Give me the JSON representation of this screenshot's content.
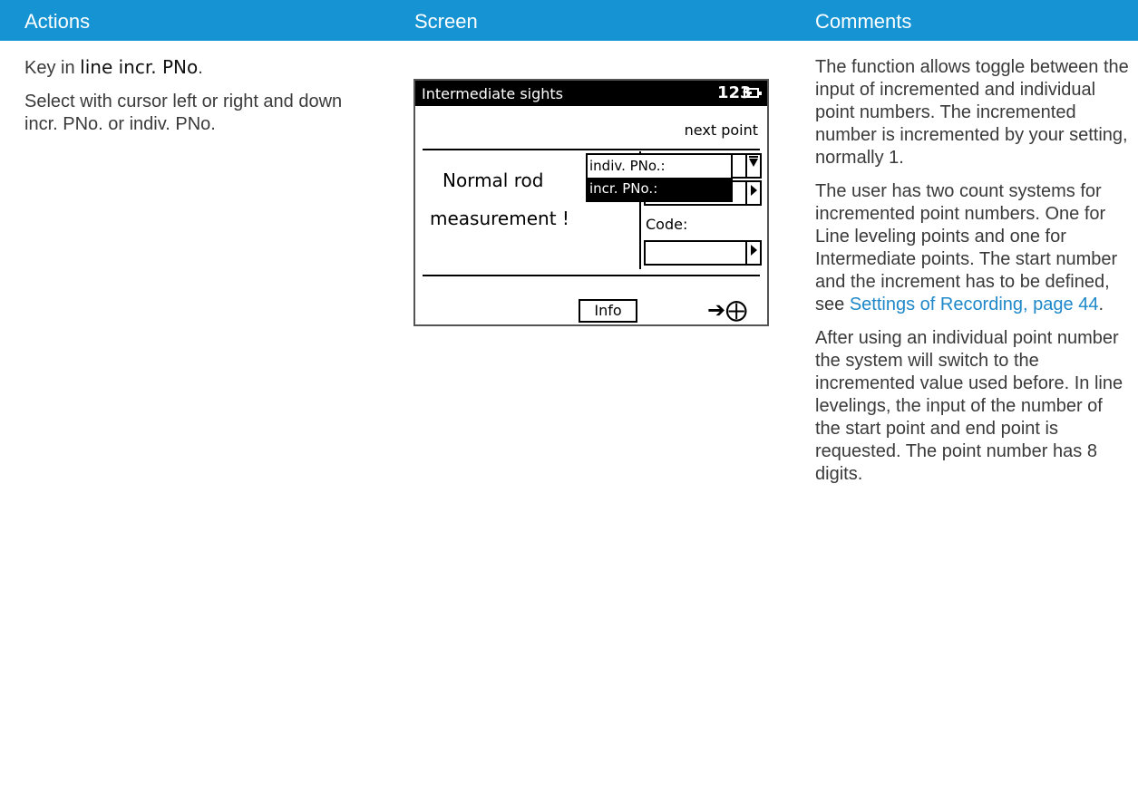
{
  "header": {
    "actions": "Actions",
    "screen": "Screen",
    "comments": "Comments"
  },
  "actions": {
    "p1_prefix": "Key in ",
    "p1_keyword": "line incr. PNo",
    "p1_suffix": ".",
    "p2": "Select with cursor left or right and down incr. PNo. or indiv. PNo."
  },
  "device": {
    "title": "Intermediate sights",
    "mode": "123",
    "next_point": "next point",
    "message_line1": "Normal rod",
    "message_line2": "measurement !",
    "dropdown_option_1": "indiv. PNo.:",
    "dropdown_option_2": "incr. PNo.:",
    "code_label": "Code:",
    "info_button": "Info",
    "measure_glyph": "➔⨁"
  },
  "comments": {
    "p1": "The function allows toggle between the input of incremented and individual point numbers. The incremented number is incremented by your setting, normally 1.",
    "p2_text": "The user has two count systems for incremented point numbers. One for Line leveling points and one for Intermediate points. The start number and the increment has to be defined, see ",
    "p2_link": "Settings of Recording, page 44",
    "p2_end": ".",
    "p3": "After using an individual point number the system will switch to the incremented value used before. In line levelings, the input of the number of the start point and end point is requested. The point number has 8 digits."
  }
}
